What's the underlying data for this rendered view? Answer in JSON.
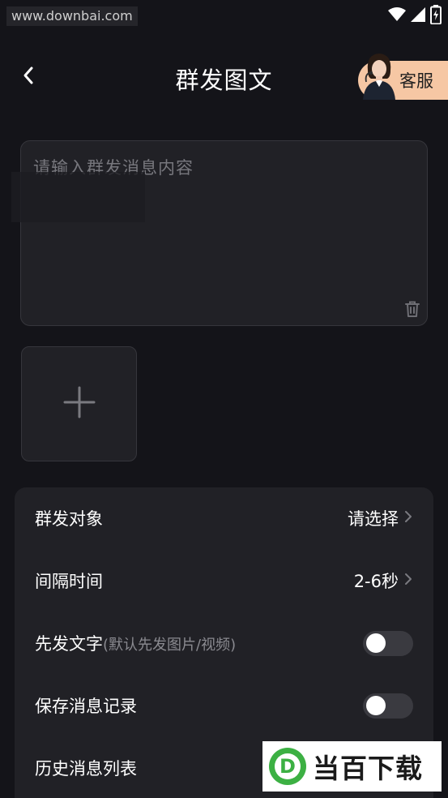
{
  "status_bar": {
    "watermark": "www.downbai.com",
    "icons": [
      "wifi-icon",
      "signal-icon",
      "battery-charging-icon"
    ]
  },
  "header": {
    "title": "群发图文",
    "back_icon": "chevron-left-icon",
    "service_label": "客服"
  },
  "message_input": {
    "placeholder": "请输入群发消息内容",
    "value": "",
    "clear_icon": "trash-icon"
  },
  "media": {
    "add_icon": "plus-icon"
  },
  "settings": {
    "target": {
      "label": "群发对象",
      "value": "请选择"
    },
    "interval": {
      "label": "间隔时间",
      "value": "2-6秒"
    },
    "send_text_first": {
      "label": "先发文字",
      "hint": "(默认先发图片/视频)",
      "enabled": false
    },
    "save_record": {
      "label": "保存消息记录",
      "enabled": false
    },
    "history": {
      "label": "历史消息列表"
    }
  },
  "overlay_logo": {
    "mark": "D",
    "text": "当百下载"
  },
  "colors": {
    "background": "#141419",
    "card": "#212126",
    "service_button": "#f6c7a4",
    "toggle_off": "#3a3a40",
    "logo_green": "#3cb043"
  }
}
